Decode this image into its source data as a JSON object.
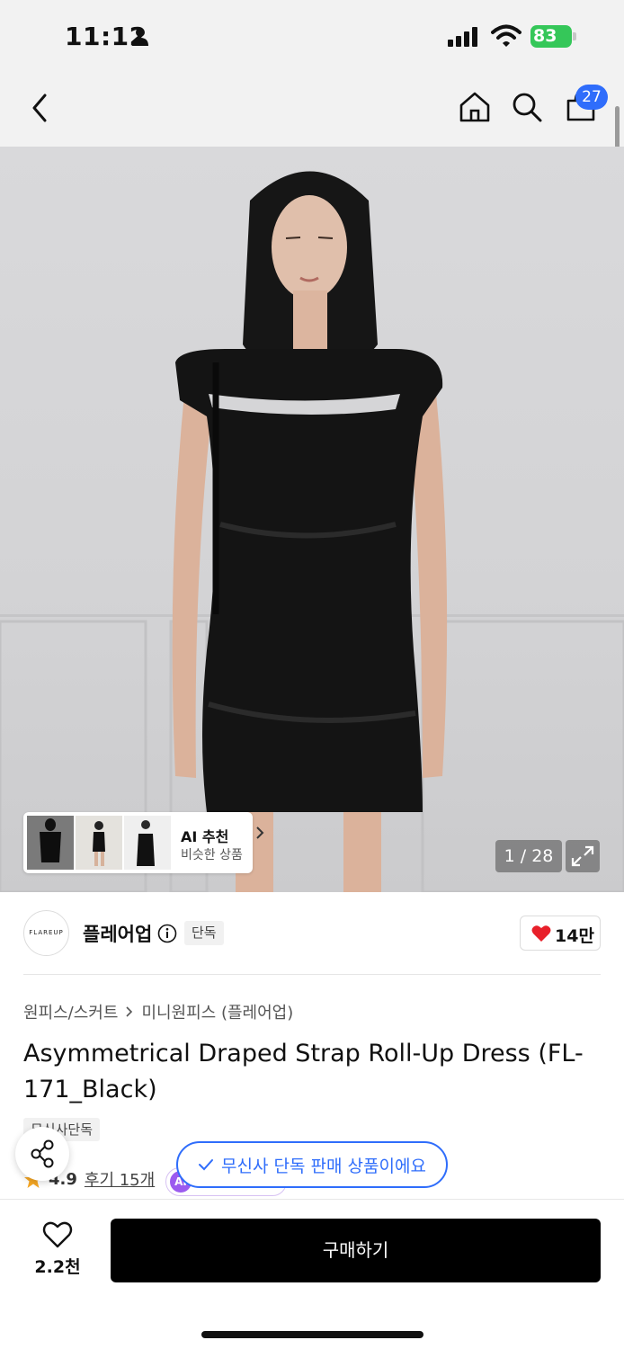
{
  "status_bar": {
    "time": "11:12",
    "battery": "83"
  },
  "nav": {
    "cart_count": "27"
  },
  "gallery": {
    "counter": "1 / 28",
    "ai_recommend": {
      "title": "AI 추천",
      "subtitle": "비슷한 상품"
    }
  },
  "brand": {
    "logo_text": "FLAREUP",
    "name": "플레어업",
    "tag": "단독",
    "like_count": "14만"
  },
  "product": {
    "breadcrumb": [
      "원피스/스커트",
      "미니원피스 (플레어업)"
    ],
    "title": "Asymmetrical Draped Strap Roll-Up Dress (FL-171_Black)",
    "exclusive_tag": "무신사단독",
    "rating": "4.9",
    "reviews": "후기 15개",
    "ai_chip": "AI"
  },
  "toast": {
    "text": "무신사 단독 판매 상품이에요"
  },
  "bottom_bar": {
    "wish_count": "2.2천",
    "buy_label": "구매하기"
  },
  "colors": {
    "accent": "#2f6dfb",
    "heart": "#e8202a",
    "battery": "#35c759",
    "star": "#f5a623"
  }
}
